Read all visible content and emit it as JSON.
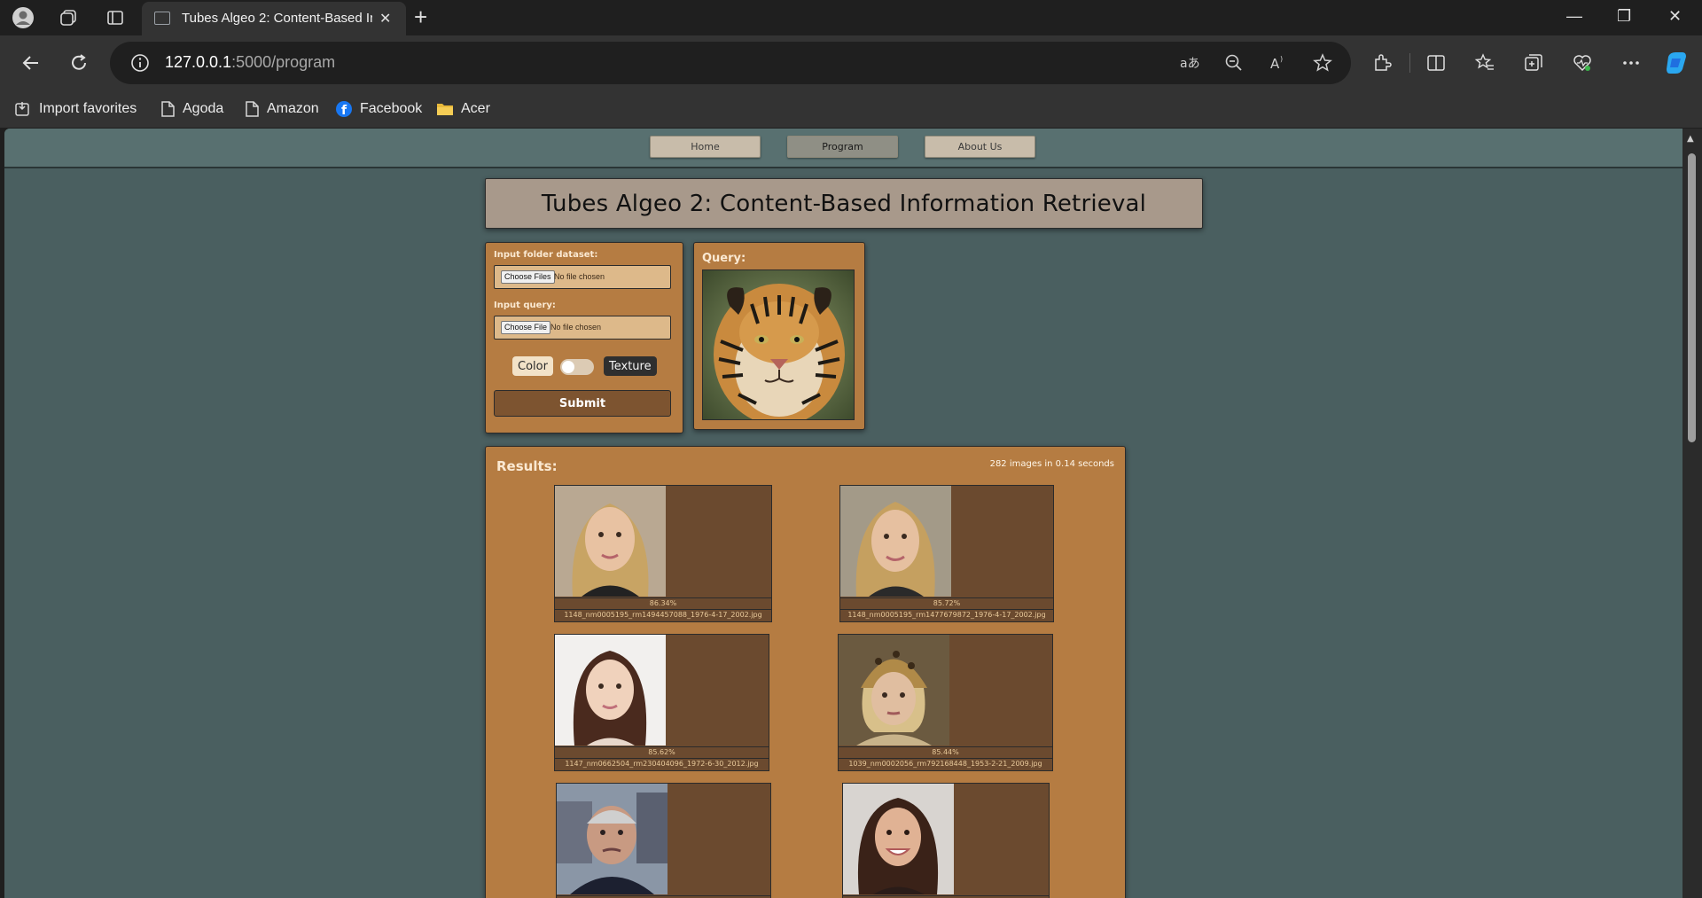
{
  "browser": {
    "tab_title": "Tubes Algeo 2: Content-Based In",
    "tab_close": "✕",
    "new_tab": "+",
    "url_host": "127.0.0.1",
    "url_path": ":5000/program",
    "window_controls": {
      "minimize": "—",
      "restore": "❐",
      "close": "✕"
    },
    "bookmarks": [
      {
        "label": "Import favorites",
        "icon": "import-icon"
      },
      {
        "label": "Agoda",
        "icon": "page-icon"
      },
      {
        "label": "Amazon",
        "icon": "page-icon"
      },
      {
        "label": "Facebook",
        "icon": "facebook-icon"
      },
      {
        "label": "Acer",
        "icon": "folder-icon"
      }
    ]
  },
  "site_nav": {
    "items": [
      {
        "label": "Home"
      },
      {
        "label": "Program"
      },
      {
        "label": "About Us"
      }
    ],
    "active": "Program"
  },
  "page_title": "Tubes Algeo 2: Content-Based Information Retrieval",
  "form": {
    "dataset_label": "Input folder dataset:",
    "dataset_button": "Choose Files",
    "dataset_value": "No file chosen",
    "query_label": "Input query:",
    "query_button": "Choose File",
    "query_value": "No file chosen",
    "mode_left": "Color",
    "mode_right": "Texture",
    "submit_label": "Submit"
  },
  "query_panel": {
    "label": "Query:",
    "image": "tiger-image"
  },
  "results": {
    "label": "Results:",
    "stats": "282 images in 0.14 seconds",
    "items": [
      {
        "similarity": "86.34%",
        "filename": "1148_nm0005195_rm1494457088_1976-4-17_2002.jpg",
        "image": "blonde-woman-photo"
      },
      {
        "similarity": "85.72%",
        "filename": "1148_nm0005195_rm1477679872_1976-4-17_2002.jpg",
        "image": "blonde-woman-photo"
      },
      {
        "similarity": "85.62%",
        "filename": "1147_nm0662504_rm230404096_1972-6-30_2012.jpg",
        "image": "brunette-girl-photo"
      },
      {
        "similarity": "85.44%",
        "filename": "1039_nm0002056_rm792168448_1953-2-21_2009.jpg",
        "image": "woman-headdress-photo"
      },
      {
        "similarity": "",
        "filename": "",
        "image": "older-man-photo"
      },
      {
        "similarity": "",
        "filename": "",
        "image": "smiling-woman-photo"
      }
    ]
  }
}
